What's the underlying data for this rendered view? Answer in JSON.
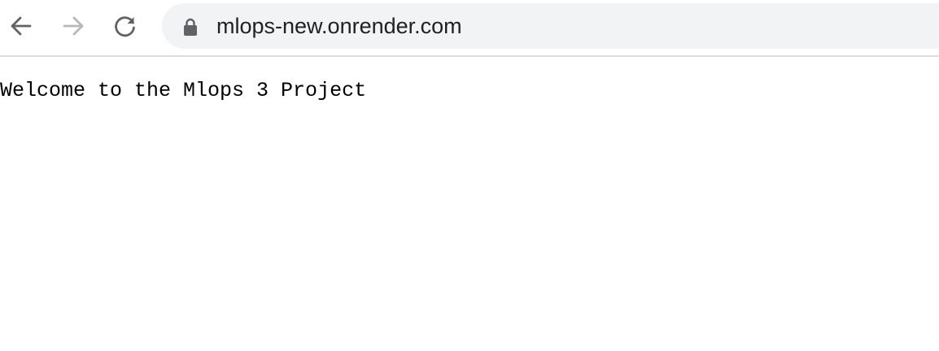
{
  "browser": {
    "address_bar": {
      "url": "mlops-new.onrender.com"
    },
    "nav": {
      "back_icon": "arrow-left-icon",
      "forward_icon": "arrow-right-icon",
      "reload_icon": "reload-icon",
      "lock_icon": "lock-icon"
    },
    "colors": {
      "icon_active": "#5f6368",
      "icon_disabled": "#b8b8b8",
      "omnibox_bg": "#f1f3f4"
    }
  },
  "page": {
    "body_text": "Welcome to the Mlops 3 Project"
  }
}
